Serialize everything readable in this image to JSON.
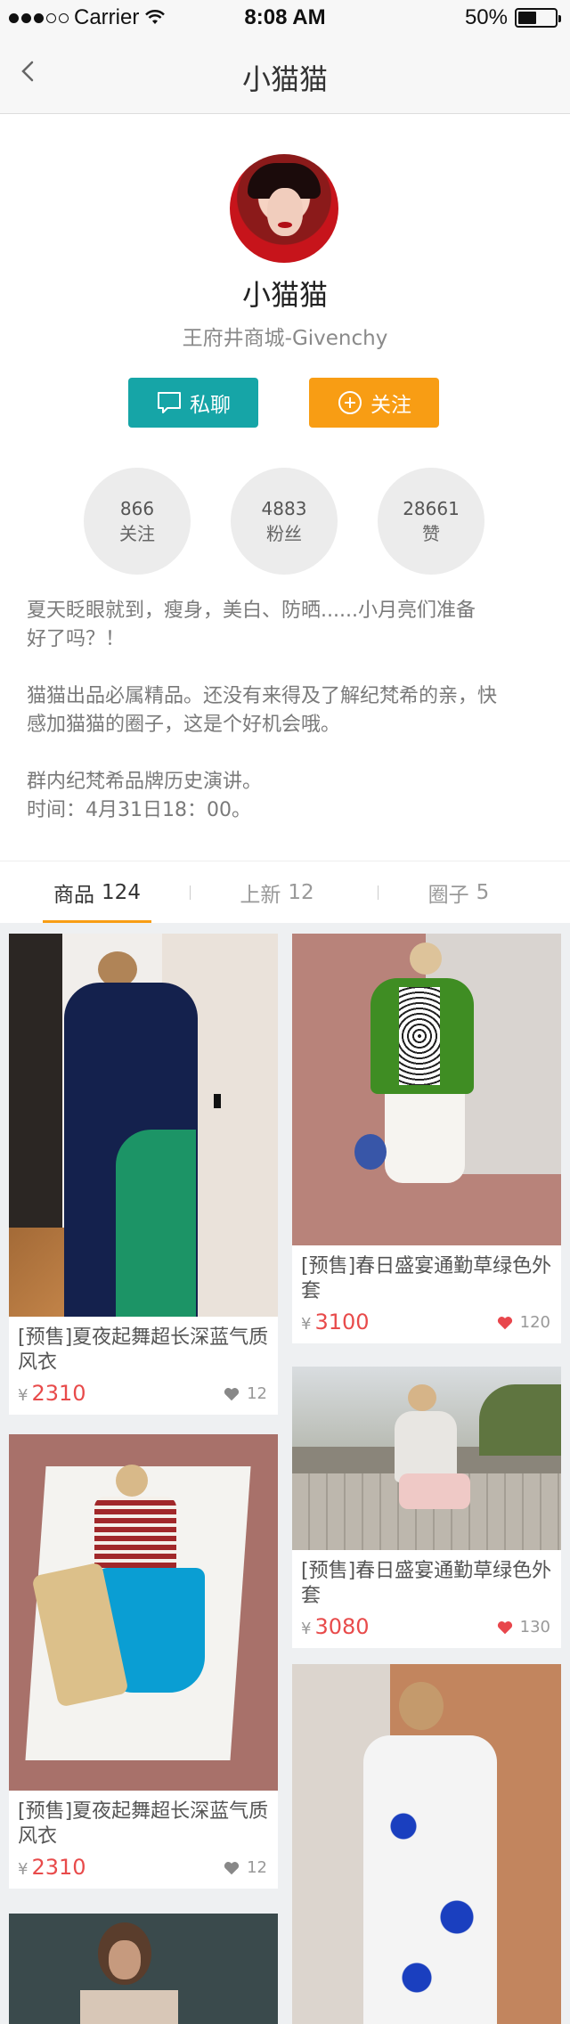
{
  "status_bar": {
    "carrier": "Carrier",
    "time": "8:08 AM",
    "battery": "50%",
    "battery_level": 0.5
  },
  "nav": {
    "title": "小猫猫"
  },
  "profile": {
    "name": "小猫猫",
    "subtitle": "王府井商城-Givenchy",
    "chat_label": "私聊",
    "follow_label": "关注",
    "stats": [
      {
        "value": "866",
        "label": "关注"
      },
      {
        "value": "4883",
        "label": "粉丝"
      },
      {
        "value": "28661",
        "label": "赞"
      }
    ],
    "bio": [
      [
        "夏天眨眼就到，瘦身，美白、防晒......小月亮们准备",
        "好了吗？！"
      ],
      [
        "猫猫出品必属精品。还没有来得及了解纪梵希的亲，快",
        "感加猫猫的圈子，这是个好机会哦。"
      ],
      [
        "群内纪梵希品牌历史演讲。",
        "时间：4月31日18：00。"
      ]
    ]
  },
  "tabs": [
    {
      "label": "商品",
      "count": "124"
    },
    {
      "label": "上新",
      "count": "12"
    },
    {
      "label": "圈子",
      "count": "5"
    }
  ],
  "products": [
    {
      "title": "[预售]夏夜起舞超长深蓝气质风衣",
      "currency": "¥",
      "price": "2310",
      "likes": "12",
      "liked": false
    },
    {
      "title": "[预售]春日盛宴通勤草绿色外套",
      "currency": "¥",
      "price": "3100",
      "likes": "120",
      "liked": true
    },
    {
      "title": "[预售]春日盛宴通勤草绿色外套",
      "currency": "¥",
      "price": "3080",
      "likes": "130",
      "liked": true
    },
    {
      "title": "[预售]夏夜起舞超长深蓝气质风衣",
      "currency": "¥",
      "price": "2310",
      "likes": "12",
      "liked": false
    }
  ],
  "colors": {
    "teal": "#16a5a7",
    "orange": "#f89d14",
    "price_red": "#e84b4b",
    "heart_red": "#e8464c"
  }
}
